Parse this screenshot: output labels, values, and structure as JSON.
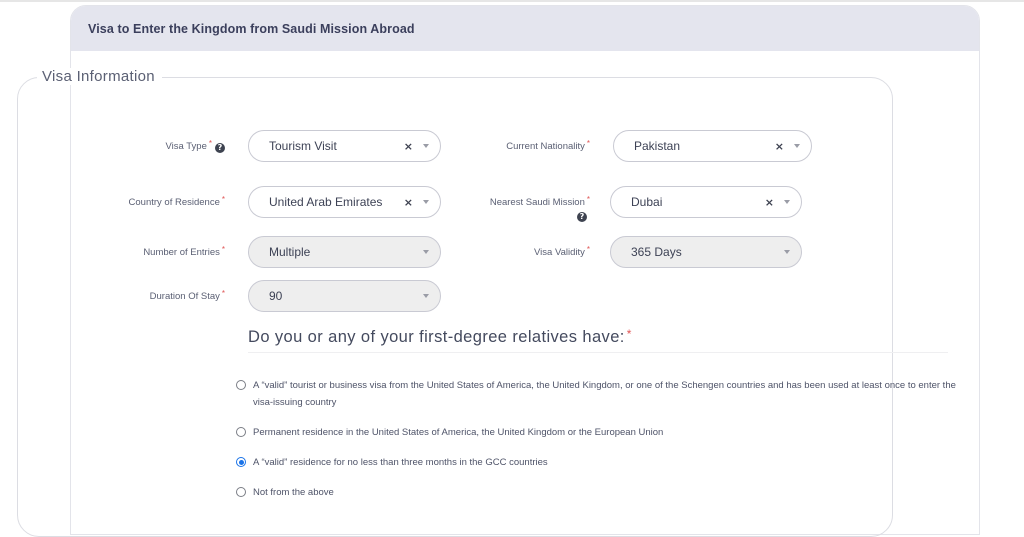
{
  "card": {
    "title": "Visa to Enter the Kingdom from Saudi Mission Abroad"
  },
  "section": {
    "legend": "Visa Information"
  },
  "fields": {
    "visa_type": {
      "label": "Visa Type",
      "required": "*",
      "value": "Tourism Visit",
      "help_icon": "question-circle-icon",
      "clear": "×"
    },
    "current_nationality": {
      "label": "Current Nationality",
      "required": "*",
      "value": "Pakistan",
      "clear": "×"
    },
    "country_of_residence": {
      "label": "Country of Residence",
      "required": "*",
      "value": "United Arab Emirates",
      "clear": "×"
    },
    "nearest_saudi_mission": {
      "label": "Nearest Saudi Mission",
      "required": "*",
      "value": "Dubai",
      "help_icon": "question-circle-icon",
      "clear": "×"
    },
    "number_of_entries": {
      "label": "Number of Entries",
      "required": "*",
      "value": "Multiple"
    },
    "visa_validity": {
      "label": "Visa Validity",
      "required": "*",
      "value": "365 Days"
    },
    "duration_of_stay": {
      "label": "Duration Of Stay",
      "required": "*",
      "value": "90"
    }
  },
  "question": {
    "text": "Do you or any of your first-degree relatives have:",
    "required": "*",
    "options": [
      {
        "label": "A “valid” tourist or business visa from the United States of America, the United Kingdom, or one of the Schengen countries and has been used at least once to enter the visa-issuing country",
        "checked": false
      },
      {
        "label": "Permanent residence in the United States of America, the United Kingdom or the European Union",
        "checked": false
      },
      {
        "label": "A “valid” residence for no less than three months in the GCC countries",
        "checked": true
      },
      {
        "label": "Not from the above",
        "checked": false
      }
    ]
  },
  "colors": {
    "header_bg": "#e4e5ee",
    "radio_selected": "#1a73e8",
    "required_marker": "#e05555"
  }
}
